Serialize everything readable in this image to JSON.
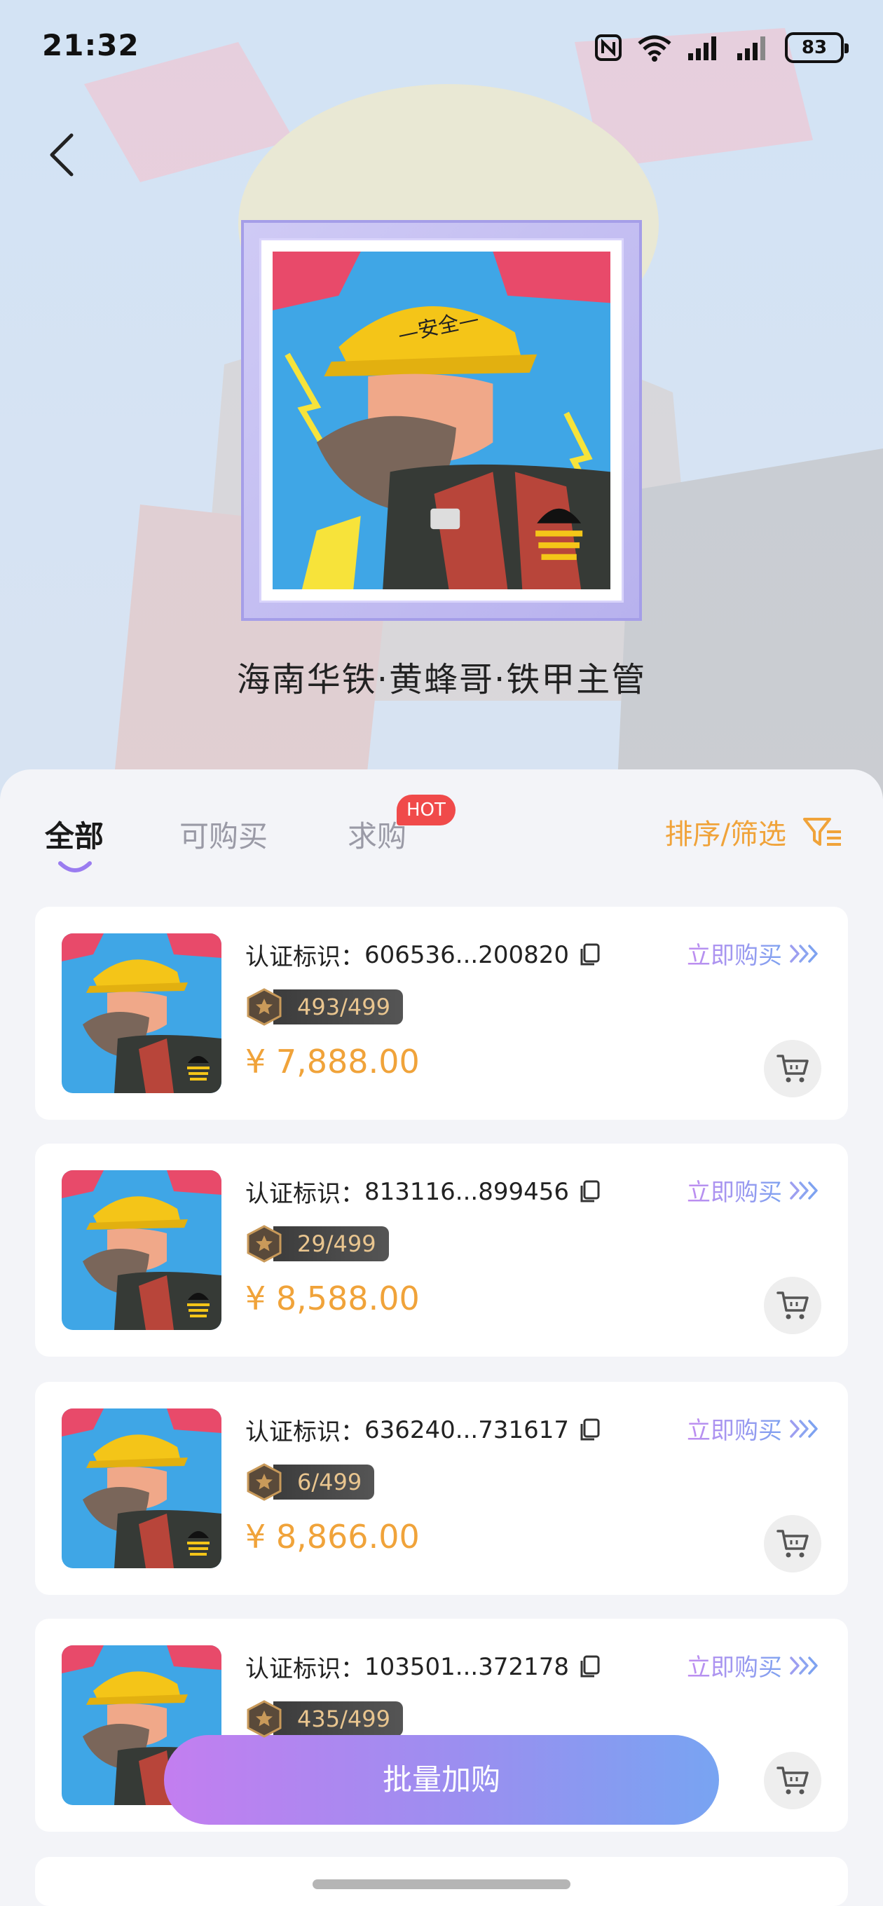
{
  "status_bar": {
    "time": "21:32",
    "battery": "83",
    "icons": [
      "nfc-icon",
      "wifi-icon",
      "signal-icon",
      "signal-icon",
      "battery-icon"
    ]
  },
  "header": {
    "back_icon": "chevron-left-icon",
    "collection_title": "海南华铁·黄蜂哥·铁甲主管"
  },
  "tabs": {
    "items": [
      {
        "label": "全部",
        "active": true
      },
      {
        "label": "可购买",
        "active": false
      },
      {
        "label": "求购",
        "active": false
      }
    ],
    "hot_badge": "HOT",
    "sort_label": "排序/筛选",
    "filter_icon": "filter-icon"
  },
  "listings": [
    {
      "cert_label": "认证标识：",
      "cert_id": "606536...200820",
      "edition": "493/499",
      "price": "¥ 7,888.00",
      "buy_label": "立即购买"
    },
    {
      "cert_label": "认证标识：",
      "cert_id": "813116...899456",
      "edition": "29/499",
      "price": "¥ 8,588.00",
      "buy_label": "立即购买"
    },
    {
      "cert_label": "认证标识：",
      "cert_id": "636240...731617",
      "edition": "6/499",
      "price": "¥ 8,866.00",
      "buy_label": "立即购买"
    },
    {
      "cert_label": "认证标识：",
      "cert_id": "103501...372178",
      "edition": "435/499",
      "price": "",
      "buy_label": "立即购买"
    }
  ],
  "bulk_button_label": "批量加购",
  "colors": {
    "accent_orange": "#f0a33a",
    "hot_red": "#f04a4a",
    "gradient_purple": "#c37ef0",
    "gradient_blue": "#78a4f2"
  }
}
